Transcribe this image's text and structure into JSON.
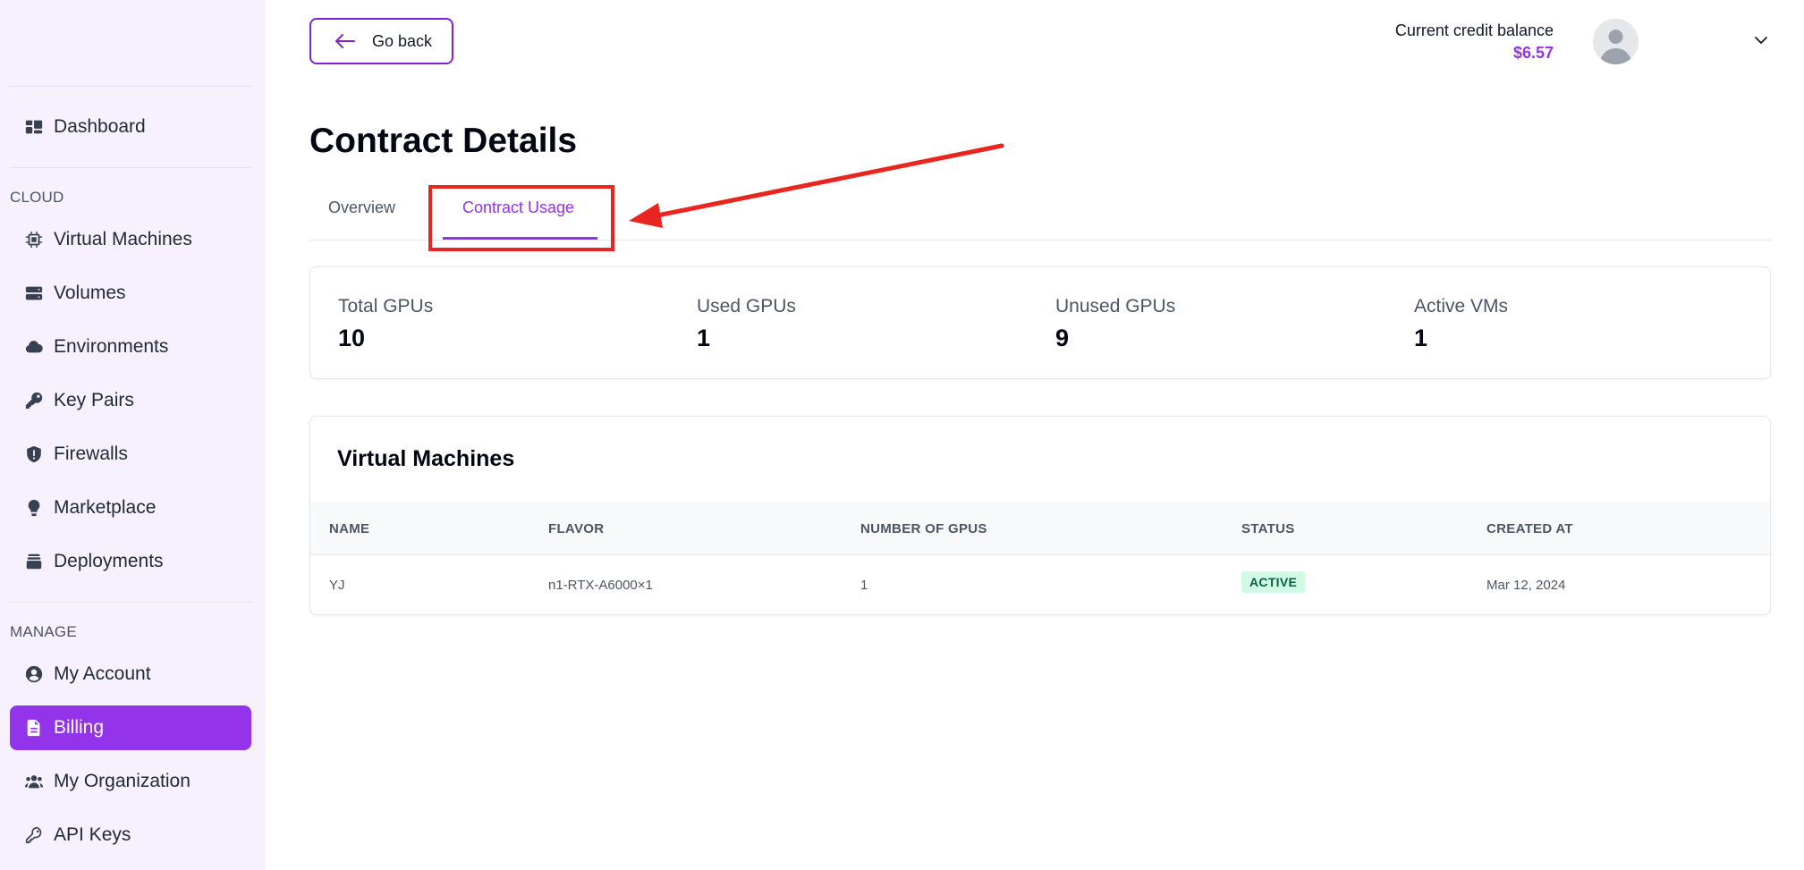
{
  "sidebar": {
    "items": [
      {
        "label": "Dashboard",
        "icon": "dashboard-icon"
      },
      {
        "label": "Virtual Machines",
        "icon": "cpu-chip-icon"
      },
      {
        "label": "Volumes",
        "icon": "server-stack-icon"
      },
      {
        "label": "Environments",
        "icon": "cloud-icon"
      },
      {
        "label": "Key Pairs",
        "icon": "key-icon"
      },
      {
        "label": "Firewalls",
        "icon": "shield-icon"
      },
      {
        "label": "Marketplace",
        "icon": "lightbulb-icon"
      },
      {
        "label": "Deployments",
        "icon": "archive-box-icon"
      },
      {
        "label": "My Account",
        "icon": "user-circle-icon"
      },
      {
        "label": "Billing",
        "icon": "document-icon"
      },
      {
        "label": "My Organization",
        "icon": "users-icon"
      },
      {
        "label": "API Keys",
        "icon": "key-outline-icon"
      }
    ],
    "sections": {
      "cloud": "CLOUD",
      "manage": "MANAGE"
    },
    "active": "Billing",
    "accent": "#9333ea"
  },
  "header": {
    "go_back": "Go back",
    "credit_label": "Current credit balance",
    "credit_value": "$6.57"
  },
  "page": {
    "title": "Contract Details",
    "tabs": [
      {
        "label": "Overview",
        "active": false
      },
      {
        "label": "Contract Usage",
        "active": true
      }
    ]
  },
  "stats": [
    {
      "label": "Total GPUs",
      "value": "10"
    },
    {
      "label": "Used GPUs",
      "value": "1"
    },
    {
      "label": "Unused GPUs",
      "value": "9"
    },
    {
      "label": "Active VMs",
      "value": "1"
    }
  ],
  "vm_table": {
    "title": "Virtual Machines",
    "columns": [
      "NAME",
      "FLAVOR",
      "NUMBER OF GPUS",
      "STATUS",
      "CREATED AT"
    ],
    "rows": [
      {
        "name": "YJ",
        "flavor": "n1-RTX-A6000×1",
        "gpus": "1",
        "status": "ACTIVE",
        "created_at": "Mar 12, 2024"
      }
    ]
  },
  "colors": {
    "brand": "#9333ea",
    "annotation": "#e8251e",
    "status_active_bg": "#d1fae5",
    "status_active_fg": "#065f46"
  }
}
